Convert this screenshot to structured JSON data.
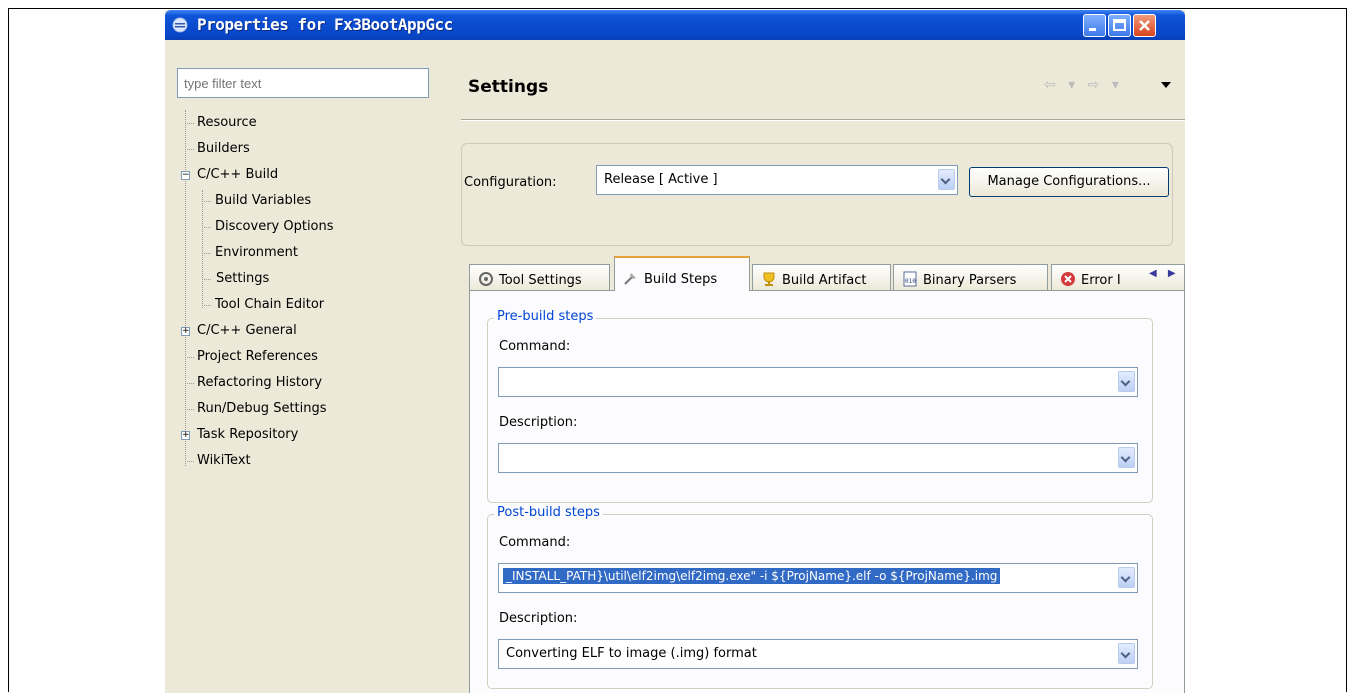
{
  "window": {
    "title": "Properties for Fx3BootAppGcc"
  },
  "filter": {
    "placeholder": "type filter text"
  },
  "tree": [
    {
      "label": "Resource",
      "depth": 0
    },
    {
      "label": "Builders",
      "depth": 0
    },
    {
      "label": "C/C++ Build",
      "depth": 0,
      "expander": "minus"
    },
    {
      "label": "Build Variables",
      "depth": 1
    },
    {
      "label": "Discovery Options",
      "depth": 1
    },
    {
      "label": "Environment",
      "depth": 1
    },
    {
      "label": "Settings",
      "depth": 1,
      "selected": true
    },
    {
      "label": "Tool Chain Editor",
      "depth": 1
    },
    {
      "label": "C/C++ General",
      "depth": 0,
      "expander": "plus"
    },
    {
      "label": "Project References",
      "depth": 0
    },
    {
      "label": "Refactoring History",
      "depth": 0
    },
    {
      "label": "Run/Debug Settings",
      "depth": 0
    },
    {
      "label": "Task Repository",
      "depth": 0,
      "expander": "plus"
    },
    {
      "label": "WikiText",
      "depth": 0
    }
  ],
  "page": {
    "title": "Settings"
  },
  "configuration": {
    "label": "Configuration:",
    "value": "Release  [ Active ]",
    "manage_button": "Manage Configurations..."
  },
  "tabs": [
    {
      "label": "Tool Settings",
      "icon": "tool-settings-icon"
    },
    {
      "label": "Build Steps",
      "icon": "build-steps-icon",
      "active": true
    },
    {
      "label": "Build Artifact",
      "icon": "build-artifact-icon"
    },
    {
      "label": "Binary Parsers",
      "icon": "binary-parsers-icon"
    },
    {
      "label": "Error I",
      "icon": "error-icon"
    }
  ],
  "pre_build": {
    "title": "Pre-build steps",
    "command_label": "Command:",
    "command_value": "",
    "description_label": "Description:",
    "description_value": ""
  },
  "post_build": {
    "title": "Post-build steps",
    "command_label": "Command:",
    "command_value": "_INSTALL_PATH}\\util\\elf2img\\elf2img.exe\" -i ${ProjName}.elf -o ${ProjName}.img",
    "description_label": "Description:",
    "description_value": "Converting ELF to image (.img) format"
  },
  "colors": {
    "titlebar": "#0a4bcf",
    "selection": "#316ac5",
    "group_title": "#0046d5",
    "active_tab_accent": "#e6a03c"
  }
}
